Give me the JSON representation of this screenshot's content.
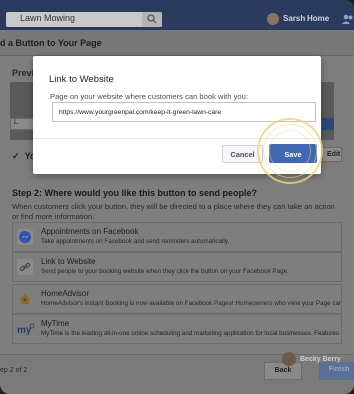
{
  "topbar": {
    "search_value": "Lawn Mowing",
    "user_name": "Sarsh",
    "home_label": "Home"
  },
  "background_dialog": {
    "title": "d a Button to Your Page",
    "preview_label": "Previ",
    "like_label": "L",
    "check_label": "Yo",
    "edit_label": "Edit",
    "step2_title": "Step 2: Where would you like this button to send people?",
    "step2_desc": "When customers click your button, they will be directed to a place where they can take an action or find more information.",
    "options": [
      {
        "title": "Appointments on Facebook",
        "desc": "Take appointments on Facebook and send reminders automatically.",
        "icon": "messenger-icon"
      },
      {
        "title": "Link to Website",
        "desc": "Send people to your booking website when they click the button on your Facebook Page.",
        "icon": "link-icon"
      },
      {
        "title": "HomeAdvisor",
        "desc": "HomeAdvisor's instant Booking is now available on Facebook Pages! Homeowners who view your Page can book",
        "icon": "homeadvisor-icon"
      },
      {
        "title": "MyTime",
        "desc": "MyTime is the leading all-in-one online scheduling and marketing application for local businesses. Features inc...",
        "icon": "mytime-icon"
      }
    ],
    "step_of": "ep 2 of 2",
    "back_label": "Back",
    "finish_label": "Finish",
    "chat_user": "Becky Berry"
  },
  "modal": {
    "title": "Link to Website",
    "subtitle": "Page on your website where customers can book with you:",
    "url_value": "https://www.yourgreenpal.com/keep-it-green-lawn-care",
    "cancel_label": "Cancel",
    "save_label": "Save"
  },
  "colors": {
    "accent": "#4267b2",
    "click_ring": "#f2d078"
  }
}
